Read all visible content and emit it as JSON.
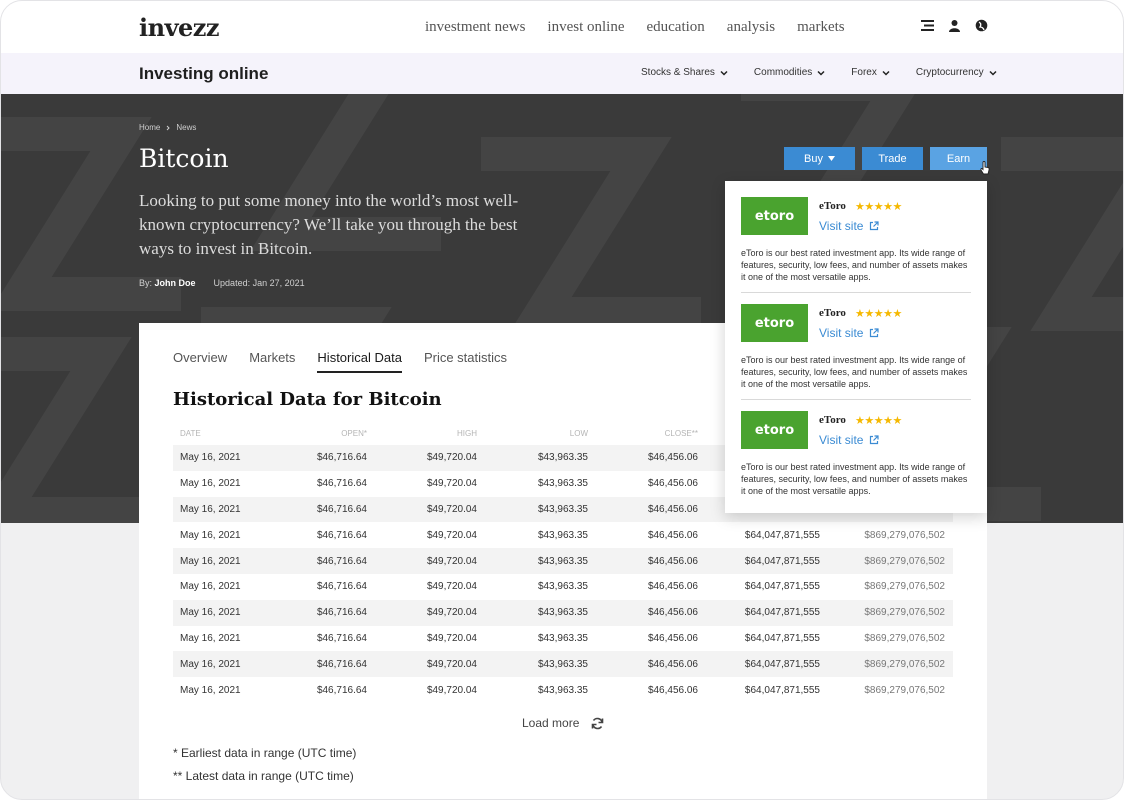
{
  "brand": {
    "logo": "invezz",
    "accent": "#e7b93a"
  },
  "topnav": {
    "links": [
      "investment news",
      "invest online",
      "education",
      "analysis",
      "markets"
    ],
    "icons": [
      "menu-icon",
      "user-icon",
      "globe-icon"
    ]
  },
  "subbar": {
    "title": "Investing online",
    "menu": [
      "Stocks & Shares",
      "Commodities",
      "Forex",
      "Cryptocurrency"
    ]
  },
  "hero": {
    "breadcrumb": [
      "Home",
      "News"
    ],
    "title": "Bitcoin",
    "description": "Looking to put some money into the world’s most well-known cryptocurrency? We’ll take you through the best ways to invest in Bitcoin.",
    "by_label": "By:",
    "author": "John Doe",
    "updated": "Updated: Jan 27, 2021",
    "buttons": {
      "buy": "Buy",
      "trade": "Trade",
      "earn": "Earn"
    },
    "button_color": "#3b8bd3"
  },
  "tabs": {
    "items": [
      "Overview",
      "Markets",
      "Historical Data",
      "Price statistics"
    ],
    "active": "Historical Data"
  },
  "section_title": "Historical Data for Bitcoin",
  "table": {
    "headers": [
      "Date",
      "Open*",
      "High",
      "Low",
      "Close**",
      "",
      ""
    ],
    "rows": [
      [
        "May 16, 2021",
        "$46,716.64",
        "$49,720.04",
        "$43,963.35",
        "$46,456.06",
        "",
        ""
      ],
      [
        "May 16, 2021",
        "$46,716.64",
        "$49,720.04",
        "$43,963.35",
        "$46,456.06",
        "",
        ""
      ],
      [
        "May 16, 2021",
        "$46,716.64",
        "$49,720.04",
        "$43,963.35",
        "$46,456.06",
        "",
        ""
      ],
      [
        "May 16, 2021",
        "$46,716.64",
        "$49,720.04",
        "$43,963.35",
        "$46,456.06",
        "$64,047,871,555",
        "$869,279,076,502"
      ],
      [
        "May 16, 2021",
        "$46,716.64",
        "$49,720.04",
        "$43,963.35",
        "$46,456.06",
        "$64,047,871,555",
        "$869,279,076,502"
      ],
      [
        "May 16, 2021",
        "$46,716.64",
        "$49,720.04",
        "$43,963.35",
        "$46,456.06",
        "$64,047,871,555",
        "$869,279,076,502"
      ],
      [
        "May 16, 2021",
        "$46,716.64",
        "$49,720.04",
        "$43,963.35",
        "$46,456.06",
        "$64,047,871,555",
        "$869,279,076,502"
      ],
      [
        "May 16, 2021",
        "$46,716.64",
        "$49,720.04",
        "$43,963.35",
        "$46,456.06",
        "$64,047,871,555",
        "$869,279,076,502"
      ],
      [
        "May 16, 2021",
        "$46,716.64",
        "$49,720.04",
        "$43,963.35",
        "$46,456.06",
        "$64,047,871,555",
        "$869,279,076,502"
      ],
      [
        "May 16, 2021",
        "$46,716.64",
        "$49,720.04",
        "$43,963.35",
        "$46,456.06",
        "$64,047,871,555",
        "$869,279,076,502"
      ]
    ]
  },
  "load_more": "Load more",
  "footnotes": [
    "* Earliest data in range (UTC time)",
    "** Latest data in range (UTC time)"
  ],
  "dropdown": {
    "offers": [
      {
        "logo_text": "etoro",
        "name": "eToro",
        "stars": "★★★★★",
        "rating": 4.5,
        "link": "Visit site",
        "description": "eToro is our best rated investment app. Its wide range of features, security, low fees, and number of assets makes it one of the most versatile apps."
      },
      {
        "logo_text": "etoro",
        "name": "eToro",
        "stars": "★★★★★",
        "rating": 4.5,
        "link": "Visit site",
        "description": "eToro is our best rated investment app. Its wide range of features, security, low fees, and number of assets makes it one of the most versatile apps."
      },
      {
        "logo_text": "etoro",
        "name": "eToro",
        "stars": "★★★★★",
        "rating": 4.5,
        "link": "Visit site",
        "description": "eToro is our best rated investment app. Its wide range of features, security, low fees, and number of assets makes it one of the most versatile apps."
      }
    ],
    "logo_color": "#4aa32f",
    "star_color": "#f5b800"
  }
}
